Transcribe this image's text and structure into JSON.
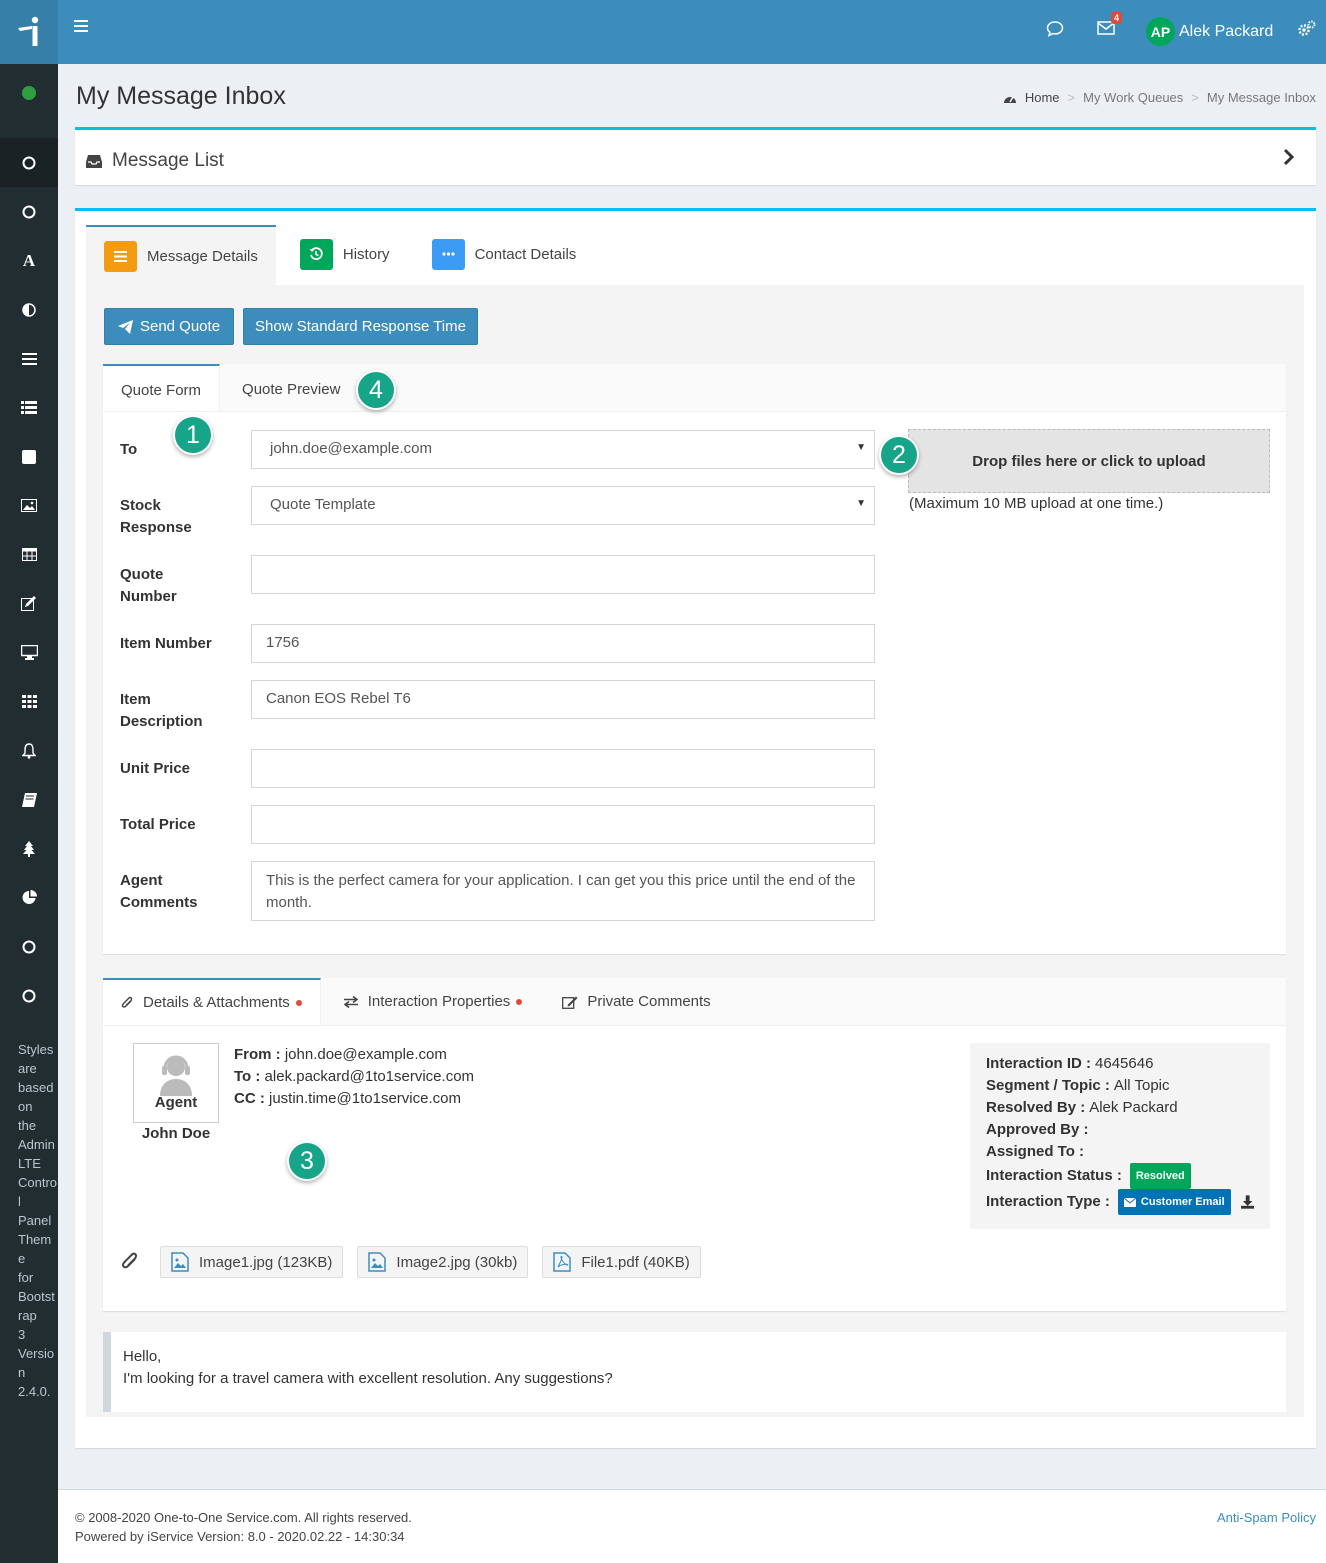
{
  "header": {
    "user_initials": "AP",
    "user_name": "Alek Packard",
    "mail_count": "4"
  },
  "sidebar": {
    "note": [
      "Styles",
      "are",
      "based",
      "on",
      "the",
      "AdminLTE",
      "Control",
      "Panel",
      "Theme",
      "for",
      "Bootstrap",
      "3",
      "Version",
      "2.4.0."
    ]
  },
  "page": {
    "title": "My Message Inbox",
    "breadcrumb": [
      "Home",
      "My Work Queues",
      "My Message Inbox"
    ]
  },
  "message_list": {
    "title": "Message List"
  },
  "main_tabs": [
    {
      "label": "Message Details",
      "color": "#f39c12"
    },
    {
      "label": "History",
      "color": "#00a65a"
    },
    {
      "label": "Contact Details",
      "color": "#3c9cf5"
    }
  ],
  "buttons": {
    "send_quote": "Send Quote",
    "show_response": "Show Standard Response Time"
  },
  "quote_tabs": [
    "Quote Form",
    "Quote Preview"
  ],
  "form": {
    "to_label": "To",
    "to_value": "john.doe@example.com",
    "stock_label_1": "Stock",
    "stock_label_2": "Response",
    "stock_value": "Quote Template",
    "quote_number_label_1": "Quote",
    "quote_number_label_2": "Number",
    "quote_number_value": "",
    "item_number_label": "Item Number",
    "item_number_value": "1756",
    "item_desc_label_1": "Item",
    "item_desc_label_2": "Description",
    "item_desc_value": "Canon EOS Rebel T6",
    "unit_price_label": "Unit Price",
    "unit_price_value": "",
    "total_price_label": "Total Price",
    "total_price_value": "",
    "comments_label_1": "Agent",
    "comments_label_2": "Comments",
    "comments_value": "This is the perfect camera for your application. I can get you this price until the end of the month."
  },
  "upload": {
    "drop_text": "Drop files here or click to upload",
    "note": "(Maximum 10 MB upload at one time.)"
  },
  "markers": [
    "1",
    "2",
    "3",
    "4"
  ],
  "detail_tabs": [
    "Details & Attachments",
    "Interaction Properties",
    "Private Comments"
  ],
  "agent": {
    "role": "Agent",
    "name": "John Doe"
  },
  "addresses": {
    "from_label": "From :",
    "from": "john.doe@example.com",
    "to_label": "To :",
    "to": "alek.packard@1to1service.com",
    "cc_label": "CC :",
    "cc": "justin.time@1to1service.com"
  },
  "properties": {
    "id_label": "Interaction ID :",
    "id": "4645646",
    "segment_label": "Segment / Topic :",
    "segment": "All Topic",
    "resolved_label": "Resolved By :",
    "resolved": "Alek Packard",
    "approved_label": "Approved By :",
    "assigned_label": "Assigned To :",
    "status_label": "Interaction Status :",
    "status": "Resolved",
    "status_color": "#00a65a",
    "type_label": "Interaction Type :",
    "type": "Customer Email",
    "type_color": "#0073b7"
  },
  "attachments": [
    "Image1.jpg (123KB)",
    "Image2.jpg (30kb)",
    "File1.pdf (40KB)"
  ],
  "message": {
    "line1": "Hello,",
    "line2": "I'm looking for a travel camera with excellent resolution. Any suggestions?"
  },
  "footer": {
    "copyright": "© 2008-2020 One-to-One Service.com. All rights reserved.",
    "version": "Powered by iService Version: 8.0 - 2020.02.22 - 14:30:34",
    "link": "Anti-Spam Policy"
  }
}
